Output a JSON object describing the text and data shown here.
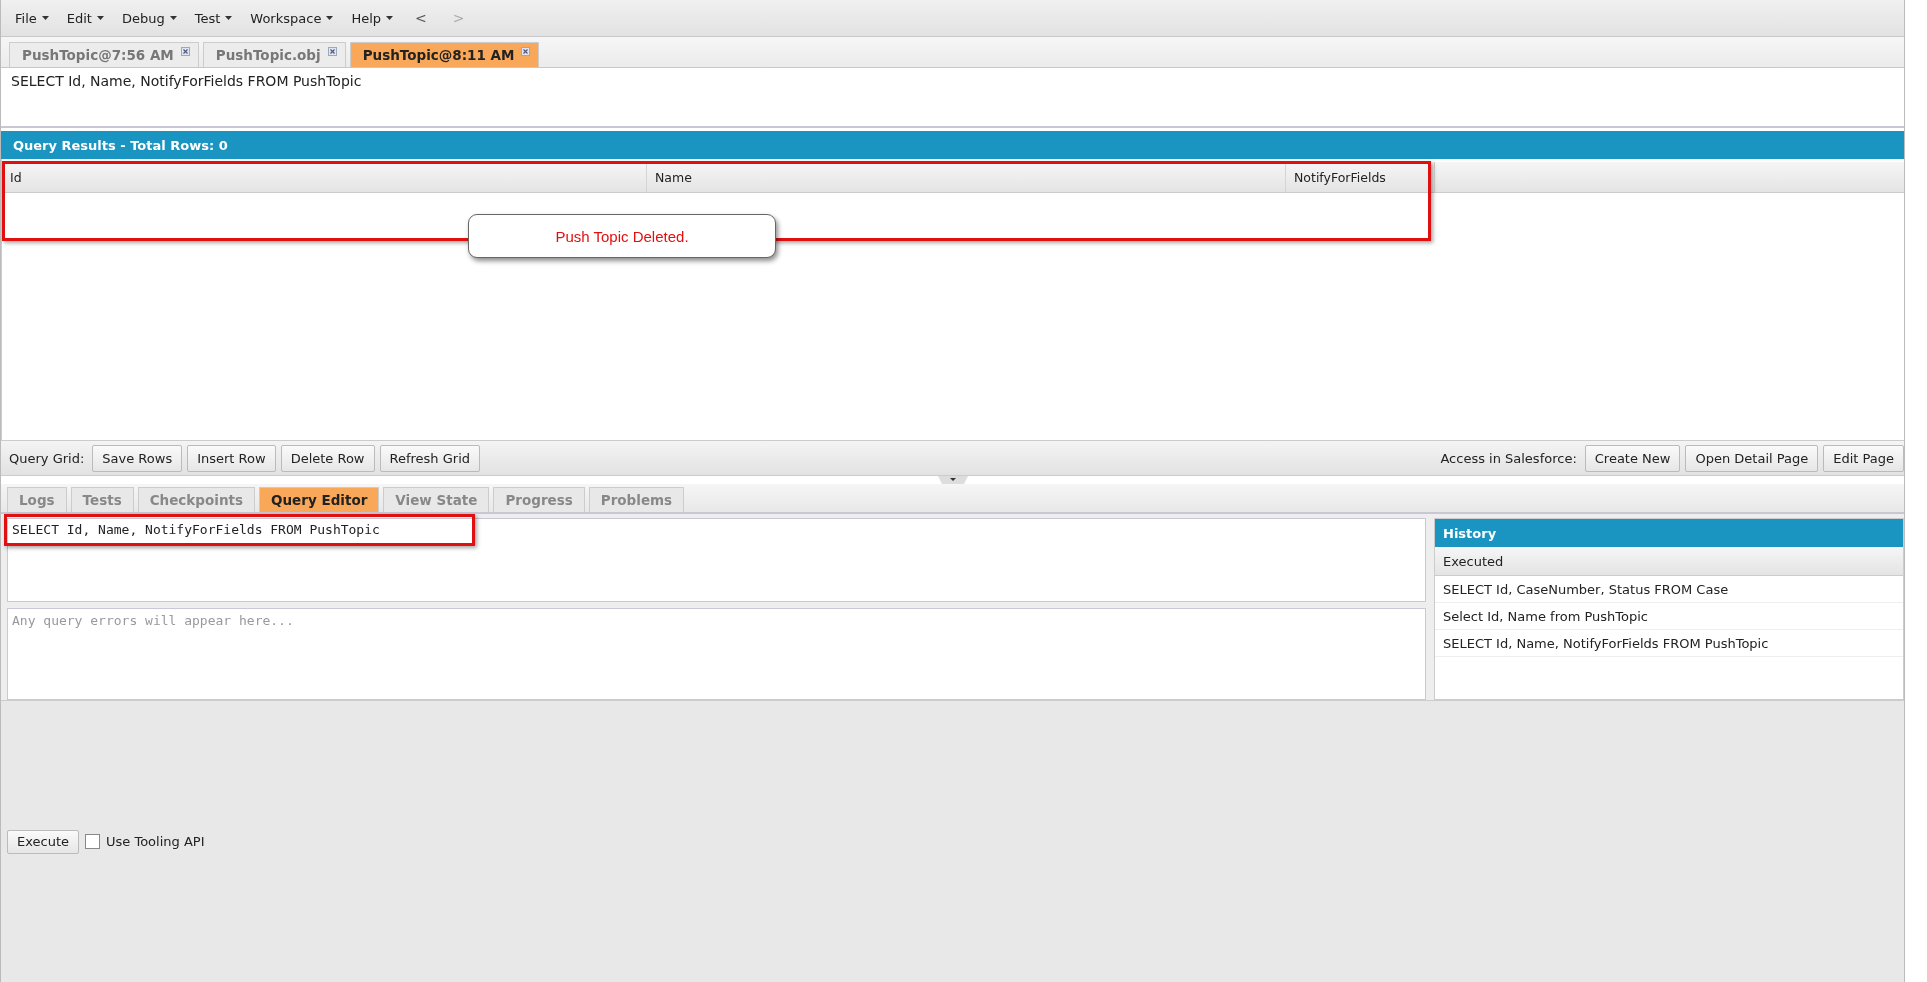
{
  "menu": {
    "items": [
      "File",
      "Edit",
      "Debug",
      "Test",
      "Workspace",
      "Help"
    ],
    "back": "<",
    "forward": ">"
  },
  "file_tabs": [
    {
      "label": "PushTopic@7:56 AM",
      "selected": false
    },
    {
      "label": "PushTopic.obj",
      "selected": false
    },
    {
      "label": "PushTopic@8:11 AM",
      "selected": true
    }
  ],
  "query_text": "SELECT Id, Name, NotifyForFields FROM PushTopic",
  "results": {
    "title": "Query Results - Total Rows: 0",
    "columns": [
      "Id",
      "Name",
      "NotifyForFields"
    ]
  },
  "callout": "Push Topic Deleted.",
  "grid_toolbar": {
    "label": "Query Grid:",
    "buttons": [
      "Save Rows",
      "Insert Row",
      "Delete Row",
      "Refresh Grid"
    ]
  },
  "access_toolbar": {
    "label": "Access in Salesforce:",
    "buttons": [
      "Create New",
      "Open Detail Page",
      "Edit Page"
    ]
  },
  "panel_tabs": [
    {
      "label": "Logs",
      "selected": false
    },
    {
      "label": "Tests",
      "selected": false
    },
    {
      "label": "Checkpoints",
      "selected": false
    },
    {
      "label": "Query Editor",
      "selected": true
    },
    {
      "label": "View State",
      "selected": false
    },
    {
      "label": "Progress",
      "selected": false
    },
    {
      "label": "Problems",
      "selected": false
    }
  ],
  "editor": {
    "value": "SELECT Id, Name, NotifyForFields FROM PushTopic",
    "errors_placeholder": "Any query errors will appear here..."
  },
  "history": {
    "title": "History",
    "column": "Executed",
    "rows": [
      "SELECT Id, CaseNumber, Status FROM Case",
      "Select Id, Name from PushTopic",
      "SELECT Id, Name, NotifyForFields FROM PushTopic"
    ]
  },
  "bottom": {
    "execute": "Execute",
    "tooling": {
      "label": "Use Tooling API",
      "checked": false
    }
  }
}
